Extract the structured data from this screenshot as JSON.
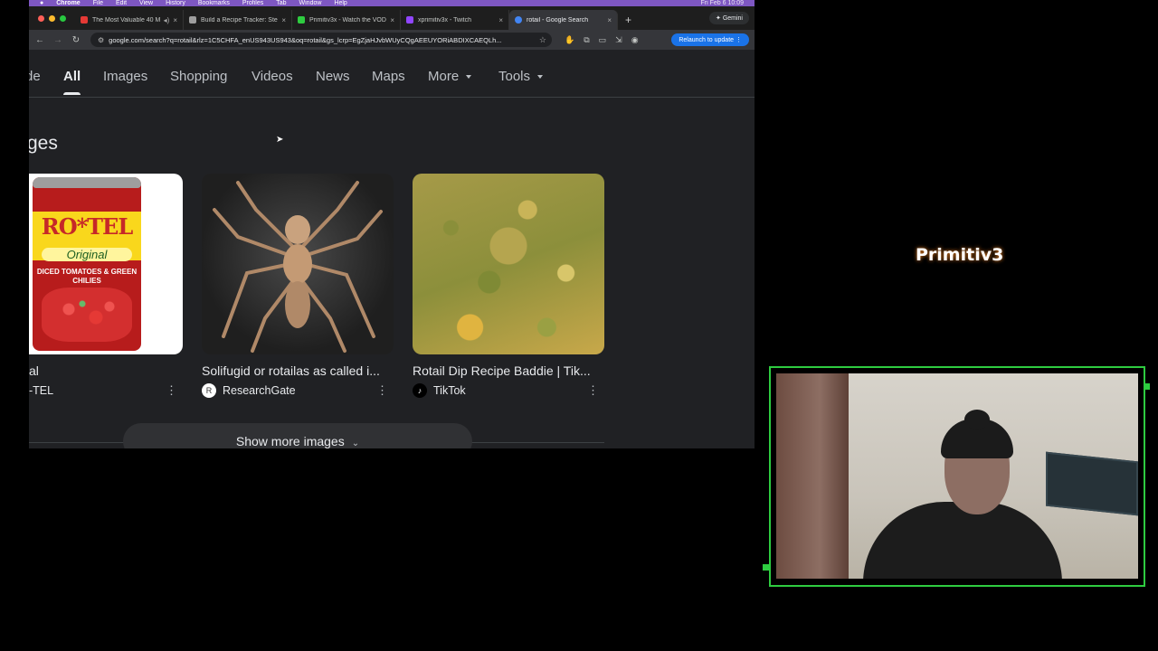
{
  "menubar": {
    "apple": "",
    "items": [
      "Chrome",
      "File",
      "Edit",
      "View",
      "History",
      "Bookmarks",
      "Profiles",
      "Tab",
      "Window",
      "Help"
    ],
    "clock": "Fri Feb 6  10:09"
  },
  "tabs": [
    {
      "title": "The Most Valuable 40 Mi",
      "color": "#e53935",
      "active": false
    },
    {
      "title": "Build a Recipe Tracker: Step",
      "color": "#9e9e9e",
      "active": false
    },
    {
      "title": "Primitiv3x - Watch the VOD",
      "color": "#2ecc40",
      "active": false
    },
    {
      "title": "xprimitiv3x - Twitch",
      "color": "#9146ff",
      "active": false
    },
    {
      "title": "rotail - Google Search",
      "color": "#4285f4",
      "active": true
    }
  ],
  "gemini_label": "Gemini",
  "toolbar": {
    "url": "google.com/search?q=rotail&rlz=1C5CHFA_enUS943US943&oq=rotail&gs_lcrp=EgZjaHJvbWUyCQgAEEUYORiABDIXCAEQLh...",
    "relaunch_label": "Relaunch to update"
  },
  "search_tabs": [
    {
      "label": "de",
      "active": false
    },
    {
      "label": "All",
      "active": true
    },
    {
      "label": "Images",
      "active": false
    },
    {
      "label": "Shopping",
      "active": false
    },
    {
      "label": "Videos",
      "active": false
    },
    {
      "label": "News",
      "active": false
    },
    {
      "label": "Maps",
      "active": false
    },
    {
      "label": "More",
      "active": false
    },
    {
      "label": "Tools",
      "active": false
    }
  ],
  "section_title": "ges",
  "image_results": [
    {
      "title": "al",
      "source": "-TEL",
      "source_icon": "",
      "can_brand": "RO*TEL",
      "can_variant": "Original",
      "can_desc": "DICED TOMATOES & GREEN CHILIES"
    },
    {
      "title": "Solifugid or rotailas as called i...",
      "source": "ResearchGate",
      "source_icon": "R"
    },
    {
      "title": "Rotail Dip Recipe Baddie | Tik...",
      "source": "TikTok",
      "source_icon": "♪"
    }
  ],
  "show_more_label": "Show more images",
  "overlay": {
    "brand": "Primitiv3"
  }
}
